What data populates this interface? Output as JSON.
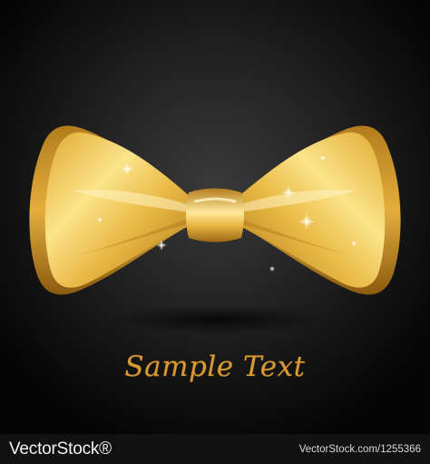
{
  "caption": "Sample Text",
  "footer": {
    "brand": "VectorStock®",
    "image_id": "VectorStock.com/1255366"
  },
  "illustration": {
    "subject": "gold bow tie",
    "background_color": "#1a1a1a",
    "accent_color": "#d99a35"
  }
}
